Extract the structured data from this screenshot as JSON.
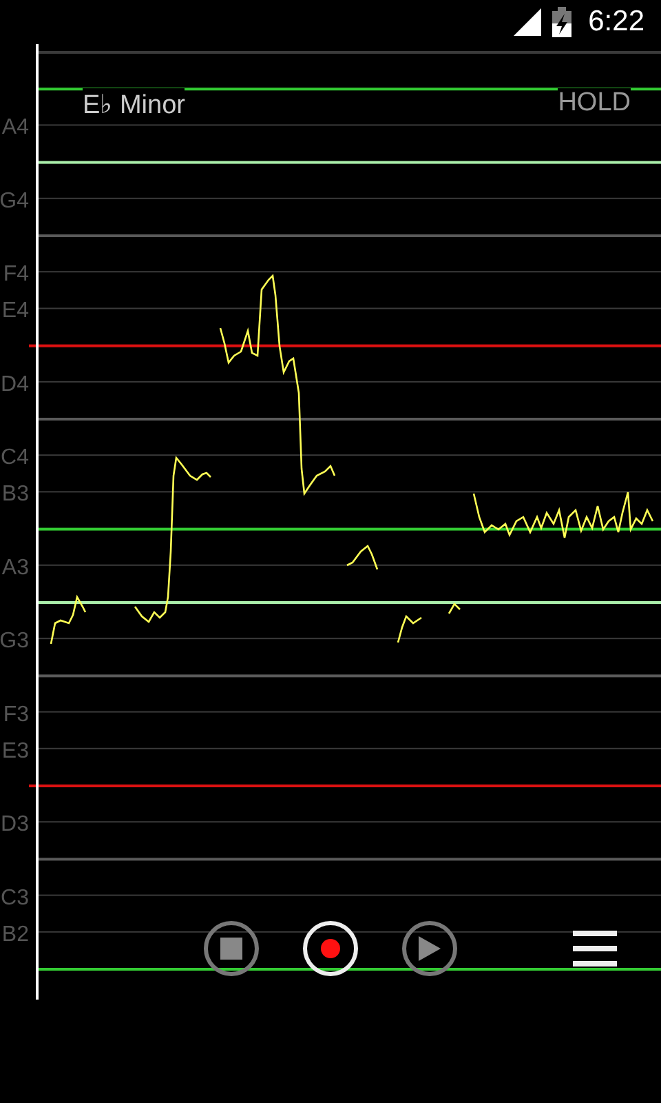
{
  "status_bar": {
    "time": "6:22"
  },
  "header": {
    "key": "E♭ Minor",
    "mode": "HOLD"
  },
  "staff": [
    {
      "color": "#3a3a3a"
    },
    {
      "color": "#33cc33"
    },
    {
      "label": "A4",
      "color": "#3a3a3a"
    },
    {
      "color": "#aaeeaa"
    },
    {
      "label": "G4",
      "color": "#3a3a3a"
    },
    {
      "color": "#5a5a5a"
    },
    {
      "label": "F4",
      "color": "#3a3a3a"
    },
    {
      "label": "E4",
      "color": "#3a3a3a"
    },
    {
      "color": "#dd1111"
    },
    {
      "label": "D4",
      "color": "#3a3a3a"
    },
    {
      "color": "#5a5a5a"
    },
    {
      "label": "C4",
      "color": "#3a3a3a"
    },
    {
      "label": "B3",
      "color": "#3a3a3a"
    },
    {
      "color": "#33cc33"
    },
    {
      "label": "A3",
      "color": "#3a3a3a"
    },
    {
      "color": "#aaeeaa"
    },
    {
      "label": "G3",
      "color": "#3a3a3a"
    },
    {
      "color": "#5a5a5a"
    },
    {
      "label": "F3",
      "color": "#3a3a3a"
    },
    {
      "label": "E3",
      "color": "#3a3a3a"
    },
    {
      "color": "#dd1111"
    },
    {
      "label": "D3",
      "color": "#3a3a3a"
    },
    {
      "color": "#5a5a5a"
    },
    {
      "label": "C3",
      "color": "#3a3a3a"
    },
    {
      "label": "B2",
      "color": "#3a3a3a"
    },
    {
      "color": "#33cc33"
    }
  ],
  "controls": [
    {
      "kind": "stop",
      "selected": false
    },
    {
      "kind": "record",
      "selected": true
    },
    {
      "kind": "play",
      "selected": false
    }
  ]
}
